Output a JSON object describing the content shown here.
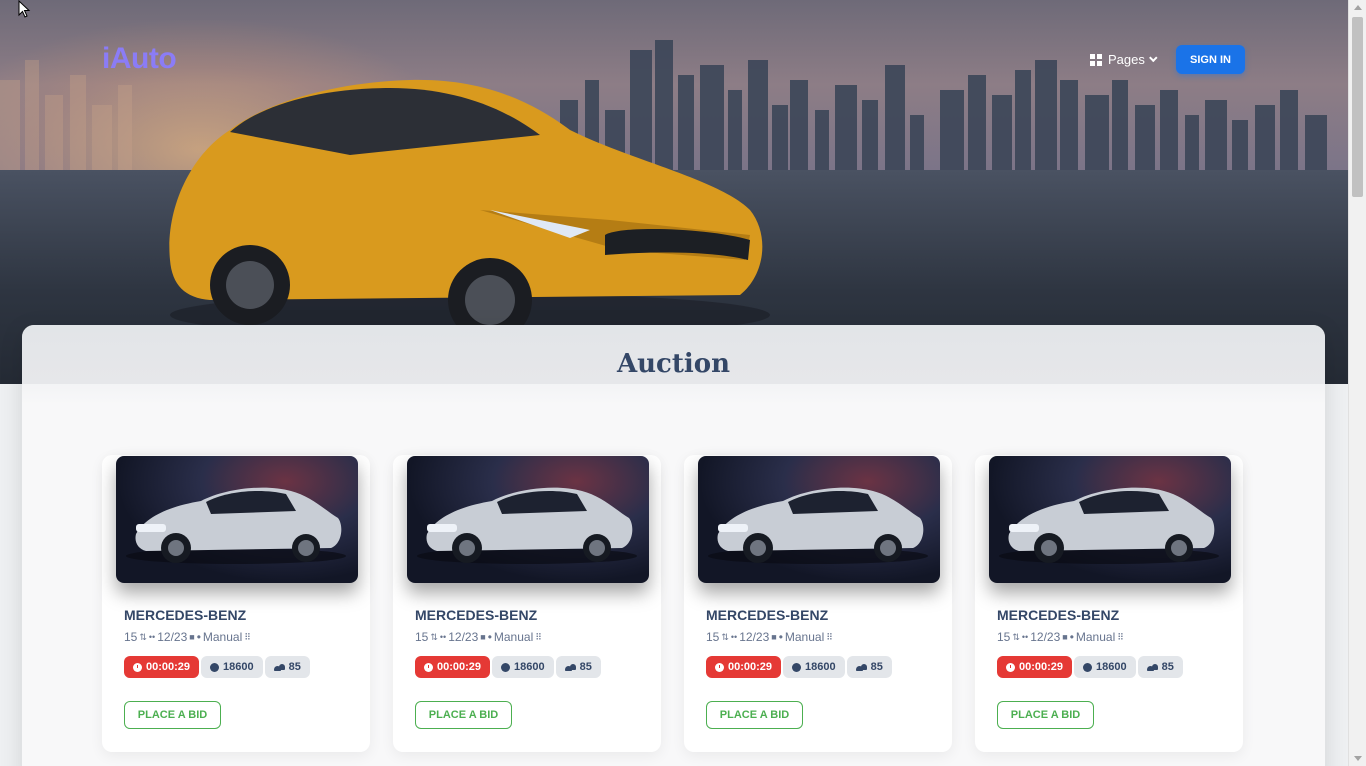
{
  "header": {
    "brand": "iAuto",
    "nav": {
      "pages_label": "Pages"
    },
    "signin_label": "SIGN IN"
  },
  "auction": {
    "title": "Auction",
    "cards": [
      {
        "title": "MERCEDES-BENZ",
        "seats": "15",
        "date": "12/23",
        "transmission": "Manual",
        "timer": "00:00:29",
        "price": "18600",
        "bidders": "85",
        "bid_label": "PLACE A BID"
      },
      {
        "title": "MERCEDES-BENZ",
        "seats": "15",
        "date": "12/23",
        "transmission": "Manual",
        "timer": "00:00:29",
        "price": "18600",
        "bidders": "85",
        "bid_label": "PLACE A BID"
      },
      {
        "title": "MERCEDES-BENZ",
        "seats": "15",
        "date": "12/23",
        "transmission": "Manual",
        "timer": "00:00:29",
        "price": "18600",
        "bidders": "85",
        "bid_label": "PLACE A BID"
      },
      {
        "title": "MERCEDES-BENZ",
        "seats": "15",
        "date": "12/23",
        "transmission": "Manual",
        "timer": "00:00:29",
        "price": "18600",
        "bidders": "85",
        "bid_label": "PLACE A BID"
      }
    ]
  },
  "icons": {
    "pages": "grid-icon",
    "dropdown": "chevron-down-icon",
    "timer": "clock-icon",
    "price": "coin-icon",
    "bidders": "people-icon"
  },
  "colors": {
    "brand": "#8b7cf6",
    "primary": "#1a73e8",
    "timer": "#e53935",
    "bid": "#4caf50",
    "title": "#344767"
  }
}
